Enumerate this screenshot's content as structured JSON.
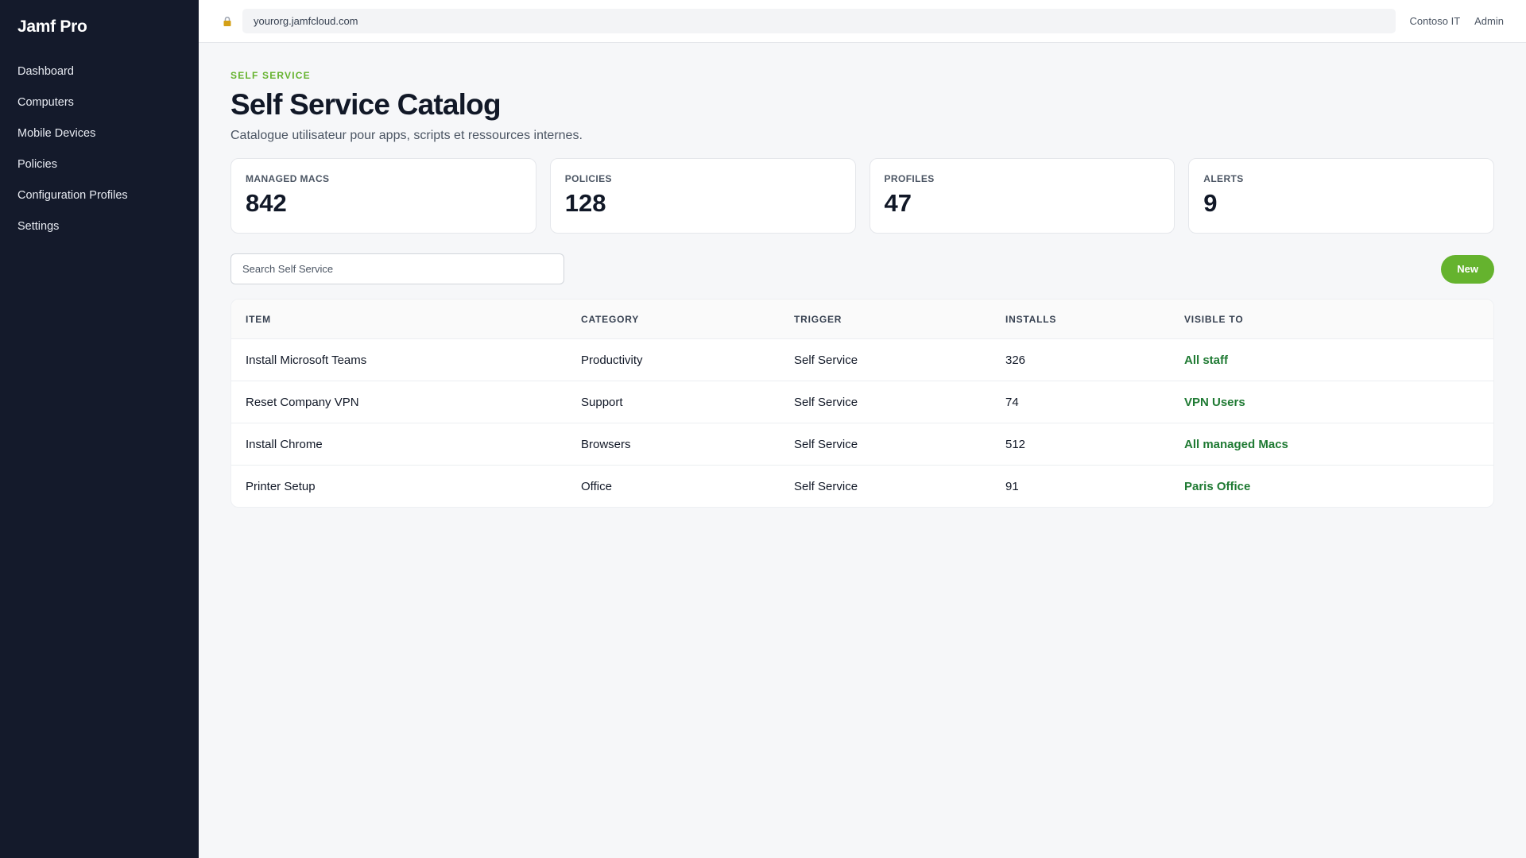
{
  "sidebar": {
    "brand": "Jamf Pro",
    "items": [
      {
        "label": "Dashboard"
      },
      {
        "label": "Computers"
      },
      {
        "label": "Mobile Devices"
      },
      {
        "label": "Policies"
      },
      {
        "label": "Configuration Profiles"
      },
      {
        "label": "Settings"
      }
    ]
  },
  "topbar": {
    "url": "yourorg.jamfcloud.com",
    "org": "Contoso IT",
    "user": "Admin"
  },
  "header": {
    "eyebrow": "SELF SERVICE",
    "title": "Self Service Catalog",
    "subtitle": "Catalogue utilisateur pour apps, scripts et ressources internes."
  },
  "stats": [
    {
      "label": "MANAGED MACS",
      "value": "842"
    },
    {
      "label": "POLICIES",
      "value": "128"
    },
    {
      "label": "PROFILES",
      "value": "47"
    },
    {
      "label": "ALERTS",
      "value": "9"
    }
  ],
  "toolbar": {
    "search_placeholder": "Search Self Service",
    "new_label": "New"
  },
  "table": {
    "columns": [
      "ITEM",
      "CATEGORY",
      "TRIGGER",
      "INSTALLS",
      "VISIBLE TO"
    ],
    "rows": [
      [
        "Install Microsoft Teams",
        "Productivity",
        "Self Service",
        "326",
        "All staff"
      ],
      [
        "Reset Company VPN",
        "Support",
        "Self Service",
        "74",
        "VPN Users"
      ],
      [
        "Install Chrome",
        "Browsers",
        "Self Service",
        "512",
        "All managed Macs"
      ],
      [
        "Printer Setup",
        "Office",
        "Self Service",
        "91",
        "Paris Office"
      ]
    ]
  },
  "colors": {
    "sidebar_bg": "#141a2b",
    "accent": "#65b32e",
    "visible_to": "#1f7a33"
  },
  "icons": {
    "lock": "lock-icon"
  }
}
